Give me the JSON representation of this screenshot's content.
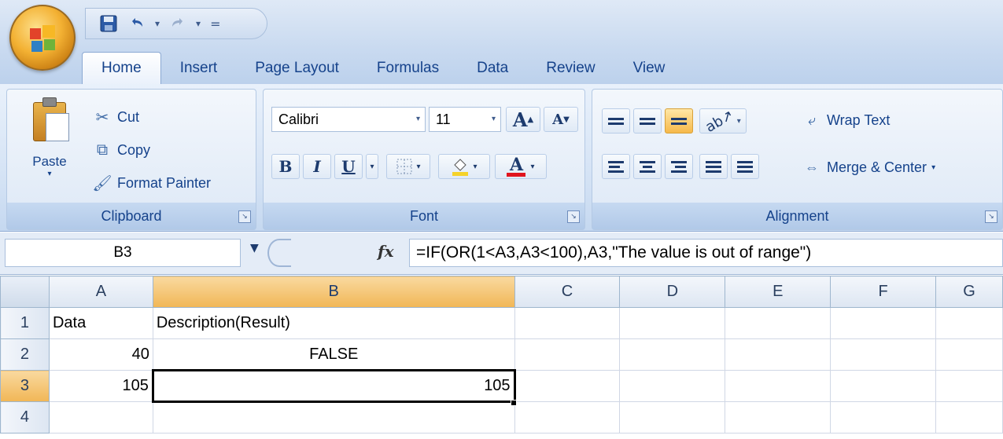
{
  "quick_access": {
    "customize_glyph": "="
  },
  "tabs": [
    {
      "label": "Home",
      "active": true
    },
    {
      "label": "Insert",
      "active": false
    },
    {
      "label": "Page Layout",
      "active": false
    },
    {
      "label": "Formulas",
      "active": false
    },
    {
      "label": "Data",
      "active": false
    },
    {
      "label": "Review",
      "active": false
    },
    {
      "label": "View",
      "active": false
    }
  ],
  "ribbon": {
    "clipboard": {
      "label": "Clipboard",
      "paste": "Paste",
      "cut": "Cut",
      "copy": "Copy",
      "format_painter": "Format Painter"
    },
    "font": {
      "label": "Font",
      "font_name": "Calibri",
      "font_size": "11",
      "grow": "A",
      "shrink": "A",
      "bold": "B",
      "italic": "I",
      "underline": "U",
      "font_color_letter": "A"
    },
    "alignment": {
      "label": "Alignment",
      "wrap_text": "Wrap Text",
      "merge_center": "Merge & Center"
    }
  },
  "formula_bar": {
    "name_box": "B3",
    "fx": "fx",
    "formula": "=IF(OR(1<A3,A3<100),A3,\"The value is out of range\")"
  },
  "sheet": {
    "columns": [
      "A",
      "B",
      "C",
      "D",
      "E",
      "F",
      "G"
    ],
    "selected_column": "B",
    "rows": [
      {
        "num": "1",
        "A": "Data",
        "B": "Description(Result)"
      },
      {
        "num": "2",
        "A": "40",
        "B": "FALSE"
      },
      {
        "num": "3",
        "A": "105",
        "B": "105"
      },
      {
        "num": "4",
        "A": "",
        "B": ""
      }
    ],
    "selected_row": "3",
    "active_cell": "B3"
  },
  "colors": {
    "ribbon_text": "#15428b",
    "selection_header": "#f1b656",
    "office_button": "#f3b133"
  }
}
